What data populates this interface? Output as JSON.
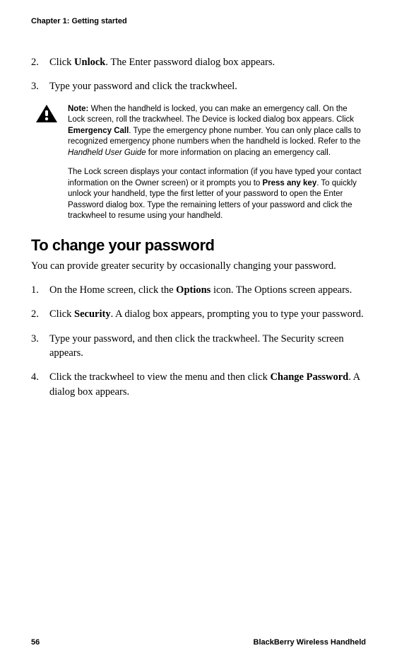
{
  "header": {
    "chapter": "Chapter 1: Getting started"
  },
  "steps_top": {
    "s2": {
      "num": "2.",
      "t1": "Click ",
      "b1": "Unlock",
      "t2": ". The Enter password dialog box appears."
    },
    "s3": {
      "num": "3.",
      "t1": "Type your password and click the trackwheel."
    }
  },
  "note": {
    "p1": {
      "b0": "Note:",
      "t1": " When the handheld is locked, you can make an emergency call. On the Lock screen, roll the trackwheel. The Device is locked dialog box appears. Click ",
      "b1": "Emergency Call",
      "t2": ". Type the emergency phone number. You can only place calls to recognized emergency phone numbers when the handheld is locked. Refer to the ",
      "i1": "Handheld User Guide",
      "t3": " for more information on placing an emergency call."
    },
    "p2": {
      "t1": "The Lock screen displays your contact information (if you have typed your contact information on the Owner screen) or it prompts you to ",
      "b1": "Press any key",
      "t2": ". To quickly unlock your handheld, type the first letter of your password to open the Enter Password dialog box. Type the remaining letters of your password and click the trackwheel to resume using your handheld."
    }
  },
  "section": {
    "heading": "To change your password",
    "intro": "You can provide greater security by occasionally changing your password."
  },
  "steps_bottom": {
    "s1": {
      "num": "1.",
      "t1": "On the Home screen, click the ",
      "b1": "Options",
      "t2": " icon. The Options screen appears."
    },
    "s2": {
      "num": "2.",
      "t1": "Click ",
      "b1": "Security",
      "t2": ". A dialog box appears, prompting you to type your password."
    },
    "s3": {
      "num": "3.",
      "t1": "Type your password, and then click the trackwheel. The Security screen appears."
    },
    "s4": {
      "num": "4.",
      "t1": "Click the trackwheel to view the menu and then click ",
      "b1": "Change Password",
      "t2": ". A dialog box appears."
    }
  },
  "footer": {
    "page": "56",
    "brand": "BlackBerry Wireless Handheld"
  }
}
